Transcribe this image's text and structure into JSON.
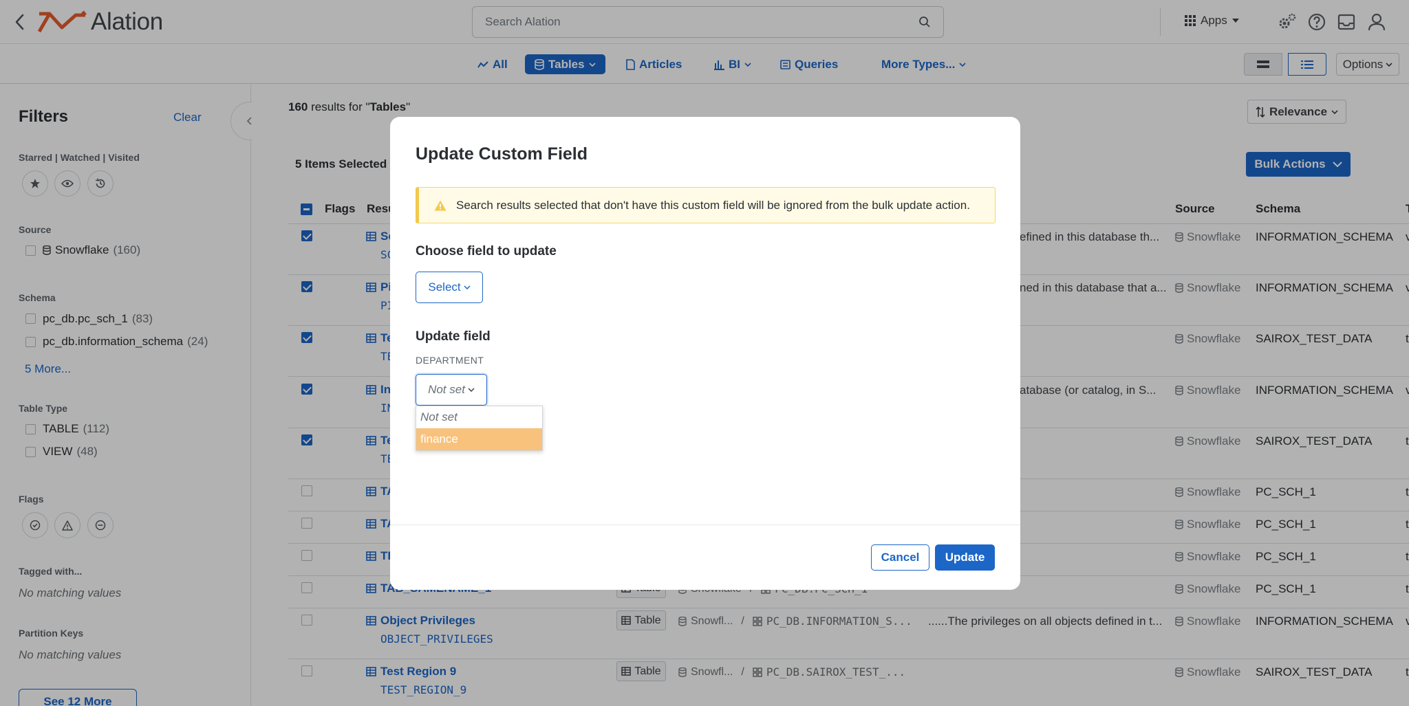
{
  "app": {
    "logo_text": "Alation"
  },
  "search": {
    "placeholder": "Search Alation"
  },
  "header": {
    "apps_label": "Apps"
  },
  "types": {
    "all": "All",
    "tables": "Tables",
    "articles": "Articles",
    "bi": "BI",
    "queries": "Queries",
    "more": "More Types..."
  },
  "toolbar": {
    "options_label": "Options",
    "relevance_label": "Relevance",
    "bulk_actions_label": "Bulk Actions"
  },
  "filters": {
    "title": "Filters",
    "clear": "Clear",
    "starred_heading": "Starred | Watched | Visited",
    "source_heading": "Source",
    "source_items": [
      {
        "label": "Snowflake",
        "count": "(160)"
      }
    ],
    "schema_heading": "Schema",
    "schema_items": [
      {
        "label": "pc_db.pc_sch_1",
        "count": "(83)"
      },
      {
        "label": "pc_db.information_schema",
        "count": "(24)"
      }
    ],
    "schema_more": "5 More...",
    "table_type_heading": "Table Type",
    "table_type_items": [
      {
        "label": "TABLE",
        "count": "(112)"
      },
      {
        "label": "VIEW",
        "count": "(48)"
      }
    ],
    "flags_heading": "Flags",
    "tagged_heading": "Tagged with...",
    "tagged_empty": "No matching values",
    "partition_heading": "Partition Keys",
    "partition_empty": "No matching values",
    "see_more": "See 12 More"
  },
  "results": {
    "count": "160",
    "count_suffix": " results for \"",
    "query": "Tables",
    "query_close": "\"",
    "selected_text": "5 Items Selected",
    "columns": {
      "flags": "Flags",
      "result": "Resu",
      "source": "Source",
      "schema": "Schema",
      "tail": "T"
    },
    "rows": [
      {
        "title": "Sc",
        "sub": "SC",
        "desc": "efined in this database th...",
        "source": "Snowflake",
        "schema": "INFORMATION_SCHEMA",
        "tail": "v",
        "checked": true
      },
      {
        "title": "Pi",
        "sub": "PI",
        "desc": "ned in this database that a...",
        "source": "Snowflake",
        "schema": "INFORMATION_SCHEMA",
        "tail": "v",
        "checked": true
      },
      {
        "title": "Te",
        "sub": "TE",
        "desc": "",
        "source": "Snowflake",
        "schema": "SAIROX_TEST_DATA",
        "tail": "t",
        "checked": true
      },
      {
        "title": "In",
        "sub": "IN",
        "desc": "atabase (or catalog, in S...",
        "source": "Snowflake",
        "schema": "INFORMATION_SCHEMA",
        "tail": "v",
        "checked": true
      },
      {
        "title": "Te",
        "sub": "TE",
        "desc": "",
        "source": "Snowflake",
        "schema": "SAIROX_TEST_DATA",
        "tail": "t",
        "checked": true
      },
      {
        "title": "TA",
        "source": "Snowflake",
        "schema": "PC_SCH_1",
        "tail": "t",
        "checked": false
      },
      {
        "title": "TA",
        "source": "Snowflake",
        "schema": "PC_SCH_1",
        "tail": "t",
        "checked": false
      },
      {
        "title": "TE",
        "source": "Snowflake",
        "schema": "PC_SCH_1",
        "tail": "t",
        "checked": false
      },
      {
        "title": "TAB_SAMENAME_1",
        "type": "Table",
        "path_source": "Snowflake",
        "path_sep": "/",
        "path_schema": "PC_DB.PC_SCH_1",
        "source": "Snowflake",
        "schema": "PC_SCH_1",
        "tail": "t",
        "checked": false
      },
      {
        "title": "Object Privileges",
        "sub": "OBJECT_PRIVILEGES",
        "type": "Table",
        "path_source": "Snowfl...",
        "path_sep": "/",
        "path_schema": "PC_DB.INFORMATION_S...",
        "desc": "......The privileges on all objects defined in t...",
        "source": "Snowflake",
        "schema": "INFORMATION_SCHEMA",
        "tail": "v",
        "checked": false
      },
      {
        "title": "Test Region 9",
        "sub": "TEST_REGION_9",
        "type": "Table",
        "path_source": "Snowfl...",
        "path_sep": "/",
        "path_schema": "PC_DB.SAIROX_TEST_...",
        "desc": "",
        "source": "Snowflake",
        "schema": "SAIROX_TEST_DATA",
        "tail": "t",
        "checked": false
      }
    ]
  },
  "modal": {
    "title": "Update Custom Field",
    "warning": "Search results selected that don't have this custom field will be ignored from the bulk update action.",
    "choose_label": "Choose field to update",
    "select_label": "Select",
    "update_field_label": "Update field",
    "field_name": "DEPARTMENT",
    "current_value": "Not set",
    "options": [
      "Not set",
      "finance"
    ],
    "highlighted_option": "finance",
    "cancel_label": "Cancel",
    "update_label": "Update"
  },
  "colors": {
    "accent": "#1c66c8",
    "highlight": "#f8c27d",
    "warning_bg": "#fffbe6",
    "warning_border": "#f2c94c"
  }
}
